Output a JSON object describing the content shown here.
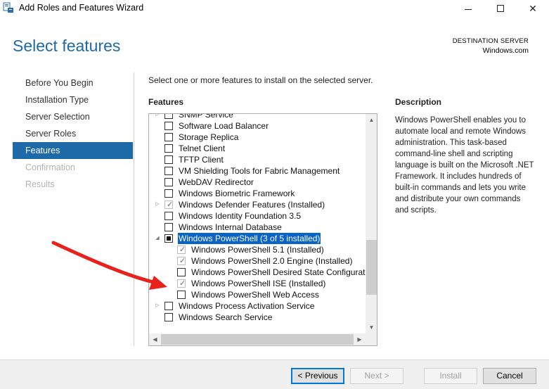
{
  "window": {
    "title": "Add Roles and Features Wizard",
    "icon": "server-manager-icon",
    "controls": [
      "minimize-icon",
      "maximize-icon",
      "close-icon"
    ]
  },
  "header": {
    "page_title": "Select features",
    "destination_label": "DESTINATION SERVER",
    "destination_value": "Windows.com"
  },
  "nav": {
    "items": [
      {
        "label": "Before You Begin",
        "state": "normal"
      },
      {
        "label": "Installation Type",
        "state": "normal"
      },
      {
        "label": "Server Selection",
        "state": "normal"
      },
      {
        "label": "Server Roles",
        "state": "normal"
      },
      {
        "label": "Features",
        "state": "active"
      },
      {
        "label": "Confirmation",
        "state": "disabled"
      },
      {
        "label": "Results",
        "state": "disabled"
      }
    ]
  },
  "main": {
    "instructions": "Select one or more features to install on the selected server.",
    "features_heading": "Features",
    "description_heading": "Description",
    "description_text": "Windows PowerShell enables you to automate local and remote Windows administration. This task-based command-line shell and scripting language is built on the Microsoft .NET Framework. It includes hundreds of built-in commands and lets you write and distribute your own commands and scripts."
  },
  "features": [
    {
      "label": "SNMP Service",
      "level": 0,
      "expander": "collapsed",
      "state": "unchecked"
    },
    {
      "label": "Software Load Balancer",
      "level": 0,
      "expander": "none",
      "state": "unchecked"
    },
    {
      "label": "Storage Replica",
      "level": 0,
      "expander": "none",
      "state": "unchecked"
    },
    {
      "label": "Telnet Client",
      "level": 0,
      "expander": "none",
      "state": "unchecked"
    },
    {
      "label": "TFTP Client",
      "level": 0,
      "expander": "none",
      "state": "unchecked"
    },
    {
      "label": "VM Shielding Tools for Fabric Management",
      "level": 0,
      "expander": "none",
      "state": "unchecked"
    },
    {
      "label": "WebDAV Redirector",
      "level": 0,
      "expander": "none",
      "state": "unchecked"
    },
    {
      "label": "Windows Biometric Framework",
      "level": 0,
      "expander": "none",
      "state": "unchecked"
    },
    {
      "label": "Windows Defender Features (Installed)",
      "level": 0,
      "expander": "collapsed",
      "state": "checked-disabled"
    },
    {
      "label": "Windows Identity Foundation 3.5",
      "level": 0,
      "expander": "none",
      "state": "unchecked"
    },
    {
      "label": "Windows Internal Database",
      "level": 0,
      "expander": "none",
      "state": "unchecked"
    },
    {
      "label": "Windows PowerShell (3 of 5 installed)",
      "level": 0,
      "expander": "expanded",
      "state": "partial",
      "selected": true
    },
    {
      "label": "Windows PowerShell 5.1 (Installed)",
      "level": 1,
      "expander": "none",
      "state": "checked-disabled"
    },
    {
      "label": "Windows PowerShell 2.0 Engine (Installed)",
      "level": 1,
      "expander": "none",
      "state": "checked-disabled"
    },
    {
      "label": "Windows PowerShell Desired State Configurati",
      "level": 1,
      "expander": "none",
      "state": "unchecked"
    },
    {
      "label": "Windows PowerShell ISE (Installed)",
      "level": 1,
      "expander": "none",
      "state": "checked-disabled"
    },
    {
      "label": "Windows PowerShell Web Access",
      "level": 1,
      "expander": "none",
      "state": "unchecked"
    },
    {
      "label": "Windows Process Activation Service",
      "level": 0,
      "expander": "collapsed",
      "state": "unchecked"
    },
    {
      "label": "Windows Search Service",
      "level": 0,
      "expander": "none",
      "state": "unchecked"
    }
  ],
  "footer": {
    "previous_label": "< Previous",
    "next_label": "Next >",
    "install_label": "Install",
    "cancel_label": "Cancel"
  },
  "colors": {
    "accent": "#1e6aa8",
    "selection": "#0a64c8",
    "annotation_arrow": "#e8211d"
  }
}
